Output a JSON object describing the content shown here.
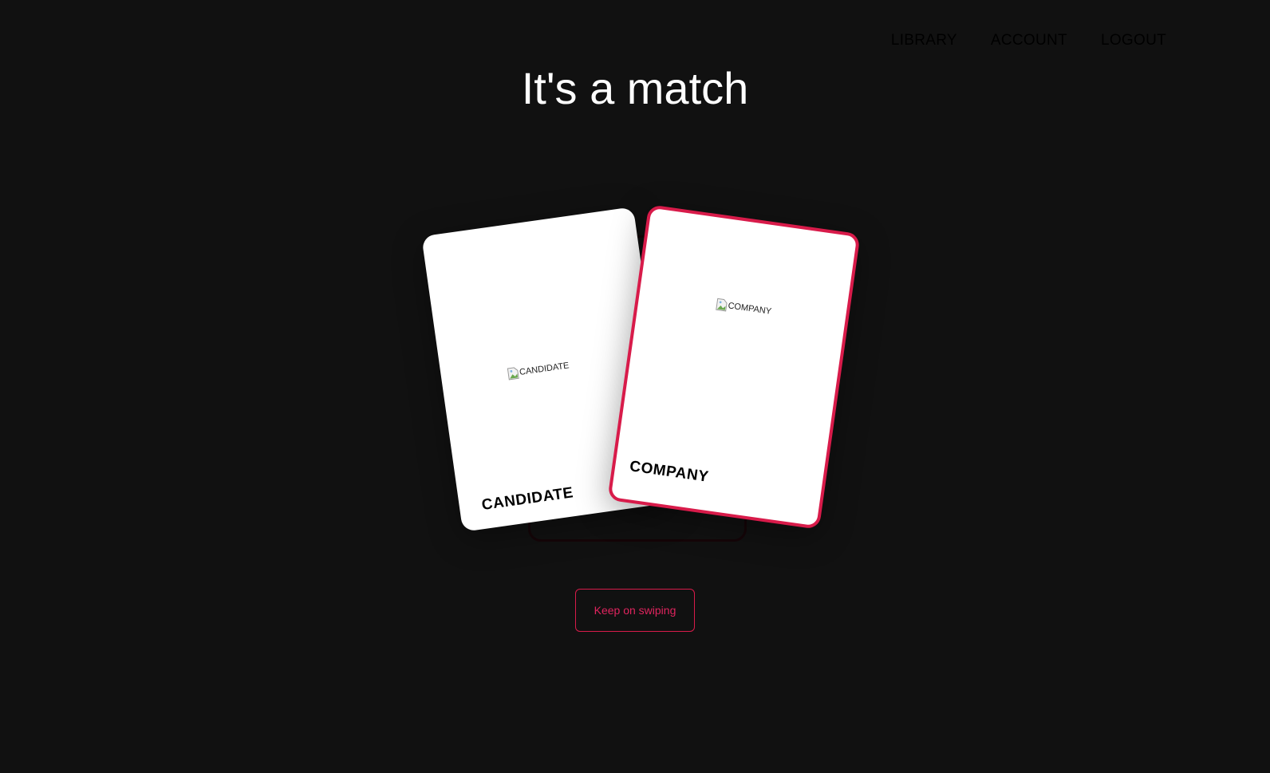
{
  "nav": {
    "items": [
      {
        "label": "LIBRARY"
      },
      {
        "label": "ACCOUNT"
      },
      {
        "label": "LOGOUT"
      }
    ]
  },
  "main": {
    "title": "It's a match",
    "cards": {
      "candidate": {
        "image_alt": "CANDIDATE",
        "label": "CANDIDATE"
      },
      "company": {
        "image_alt": "COMPANY",
        "label": "COMPANY"
      }
    },
    "button_label": "Keep on swiping"
  },
  "colors": {
    "background": "#111111",
    "accent": "#d81b4a",
    "card": "#ffffff"
  }
}
